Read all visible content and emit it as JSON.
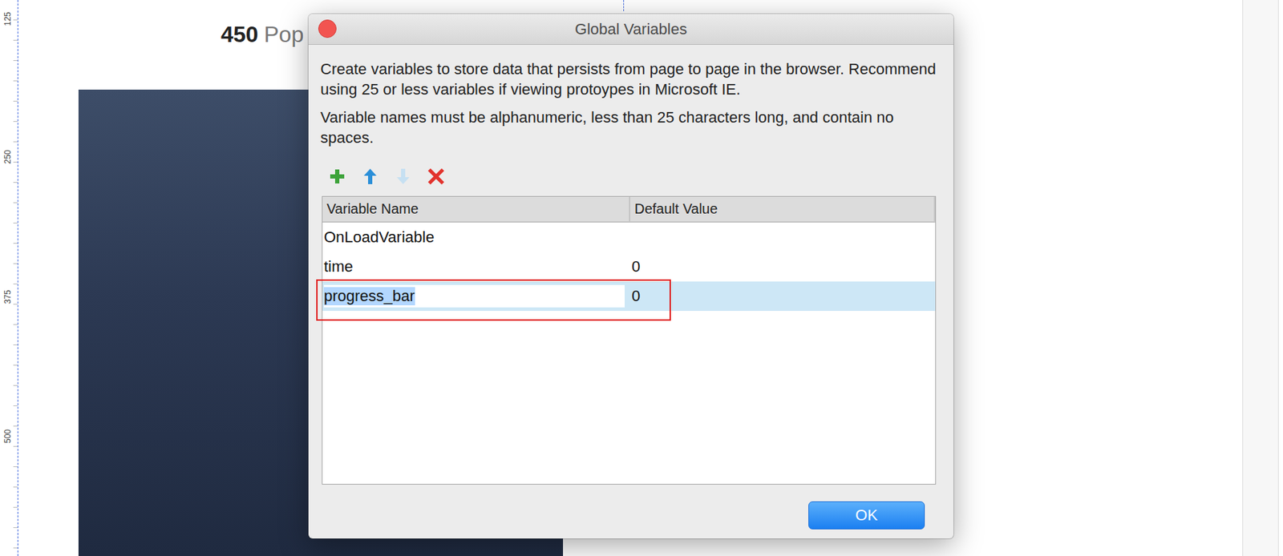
{
  "canvas": {
    "heading": {
      "number": "450",
      "text": "Pop"
    },
    "ruler": [
      "125",
      "250",
      "375",
      "500"
    ]
  },
  "dialog": {
    "title": "Global Variables",
    "paragraphs": [
      "Create variables to store data that persists from page to page in the browser. Recommend using 25 or less variables if viewing protoypes in Microsoft IE.",
      "Variable names must be alphanumeric, less than 25 characters long, and contain no spaces."
    ],
    "toolbar": [
      {
        "kind": "add",
        "disabled": false
      },
      {
        "kind": "up",
        "disabled": false
      },
      {
        "kind": "down",
        "disabled": true
      },
      {
        "kind": "delete",
        "disabled": false
      }
    ],
    "columns": [
      "Variable Name",
      "Default Value"
    ],
    "rows": [
      {
        "name": "OnLoadVariable",
        "value": "",
        "selected": false,
        "editing": false,
        "annotated": false
      },
      {
        "name": "time",
        "value": "0",
        "selected": false,
        "editing": false,
        "annotated": false
      },
      {
        "name": "progress_bar",
        "value": "0",
        "selected": true,
        "editing": true,
        "annotated": true
      }
    ],
    "buttons": [
      "OK"
    ]
  }
}
